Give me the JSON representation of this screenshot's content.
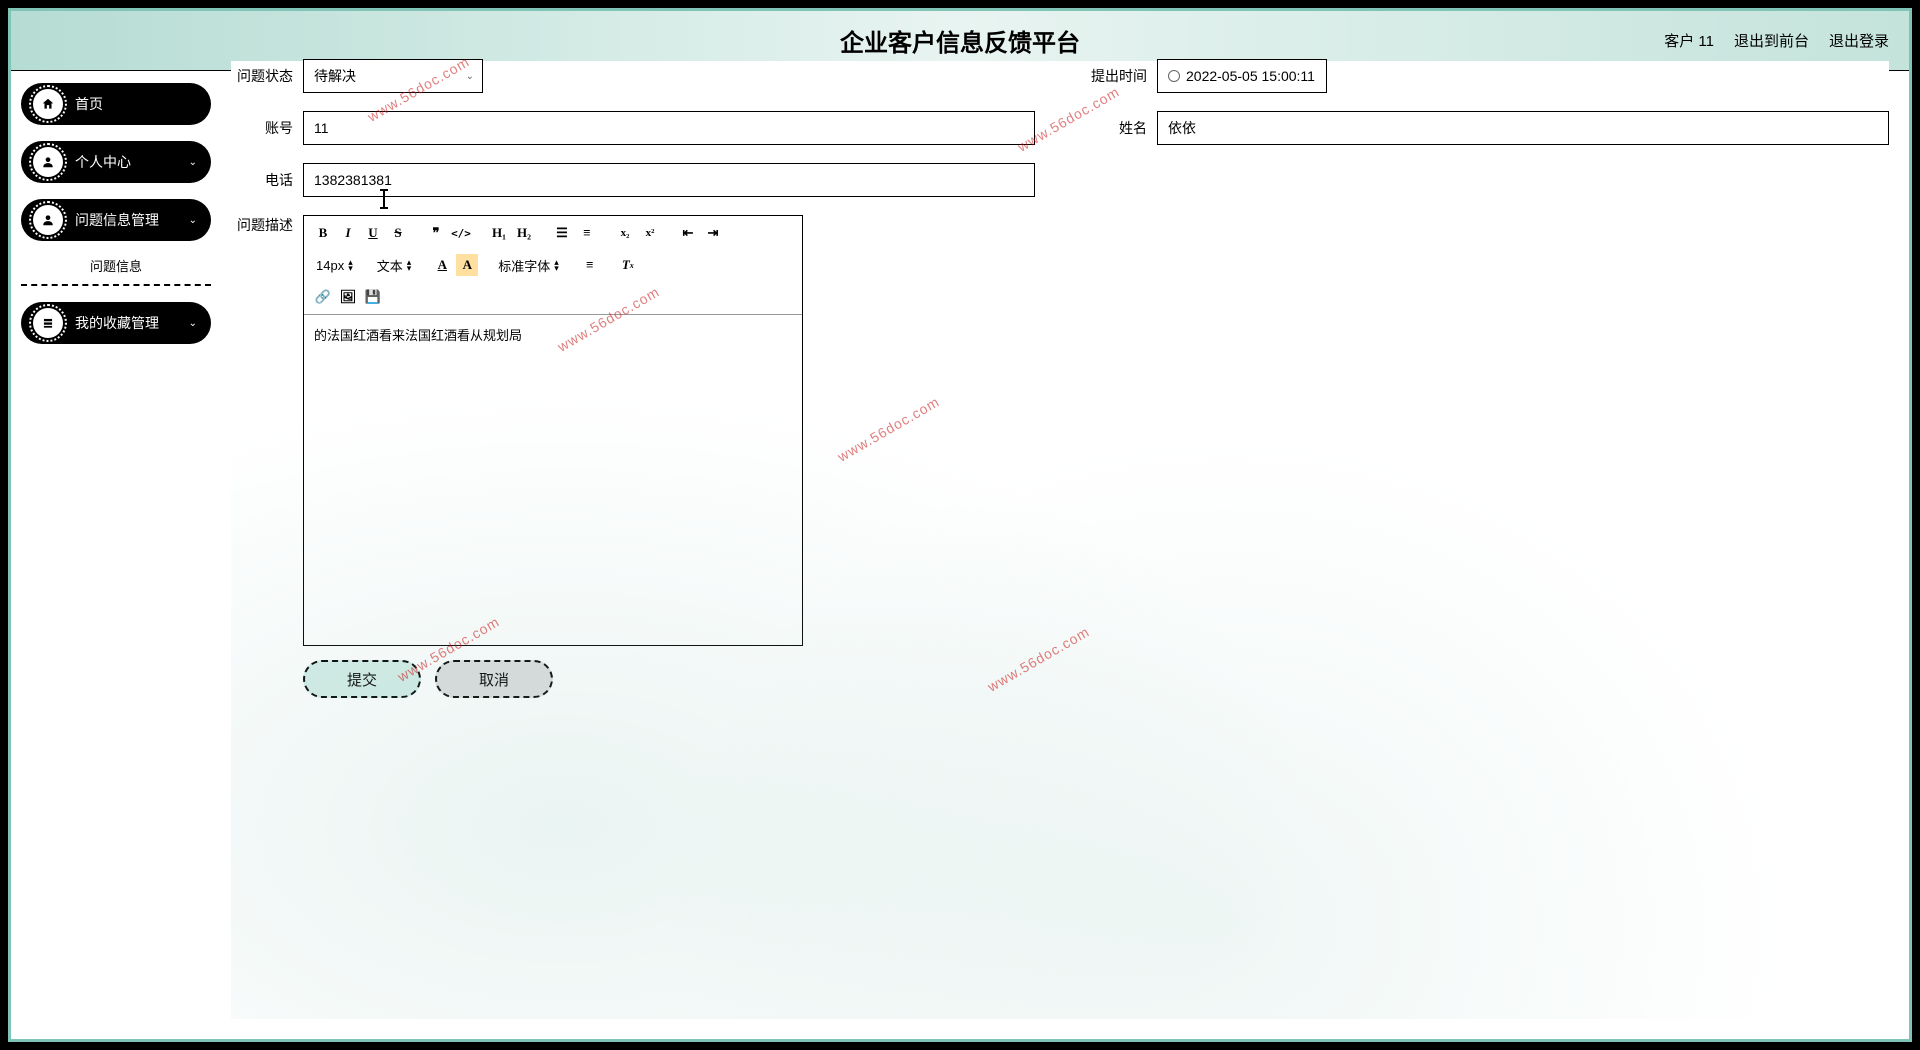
{
  "header": {
    "title": "企业客户信息反馈平台",
    "user": "客户 11",
    "back_front": "退出到前台",
    "logout": "退出登录"
  },
  "sidebar": {
    "home": "首页",
    "personal": "个人中心",
    "issue_mgmt": "问题信息管理",
    "issue_sub": "问题信息",
    "fav_mgmt": "我的收藏管理"
  },
  "form": {
    "status_label": "问题状态",
    "status_value": "待解决",
    "time_label": "提出时间",
    "time_value": "2022-05-05 15:00:11",
    "account_label": "账号",
    "account_value": "11",
    "name_label": "姓名",
    "name_value": "依依",
    "phone_label": "电话",
    "phone_value": "1382381381",
    "desc_label": "问题描述",
    "desc_text": "的法国红酒看来法国红酒看从规划局"
  },
  "editor": {
    "font_size": "14px",
    "text_type": "文本",
    "font_family": "标准字体"
  },
  "buttons": {
    "submit": "提交",
    "cancel": "取消"
  },
  "watermark": "www.56doc.com"
}
